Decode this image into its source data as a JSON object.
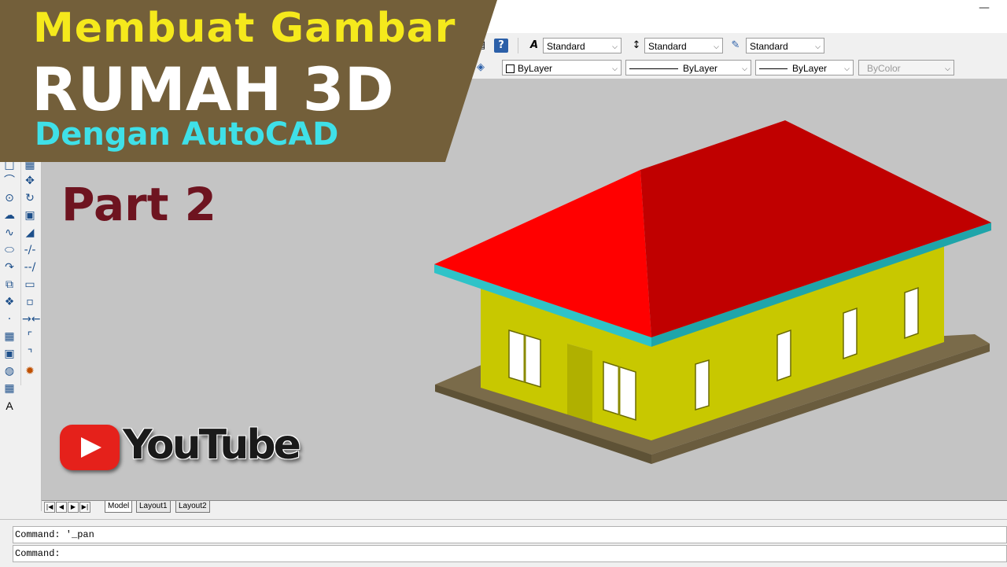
{
  "banner": {
    "line1": "Membuat Gambar",
    "line2": "RUMAH 3D",
    "line3": "Dengan AutoCAD",
    "part": "Part 2",
    "youtube": "YouTube",
    "colors": {
      "bg": "#735f3a",
      "line1": "#f5e91c",
      "line2": "#ffffff",
      "line3": "#3fe0e8",
      "part": "#6e1420"
    }
  },
  "toolbar": {
    "text_style": "Standard",
    "dim_style": "Standard",
    "table_style": "Standard",
    "layer_color": "ByLayer",
    "linetype": "ByLayer",
    "lineweight": "ByLayer",
    "plot_style": "ByColor",
    "help_icon": "help-icon"
  },
  "tabs": {
    "model": "Model",
    "layout1": "Layout1",
    "layout2": "Layout2"
  },
  "command": {
    "history": "Command: '_pan",
    "prompt": "Command:"
  },
  "house": {
    "roof_color": "#ff0000",
    "roof_shade": "#c00000",
    "fascia_color": "#2ec3c8",
    "wall_color": "#c8c800",
    "wall_shade": "#aaaa00",
    "base_color": "#7a6b4a"
  }
}
